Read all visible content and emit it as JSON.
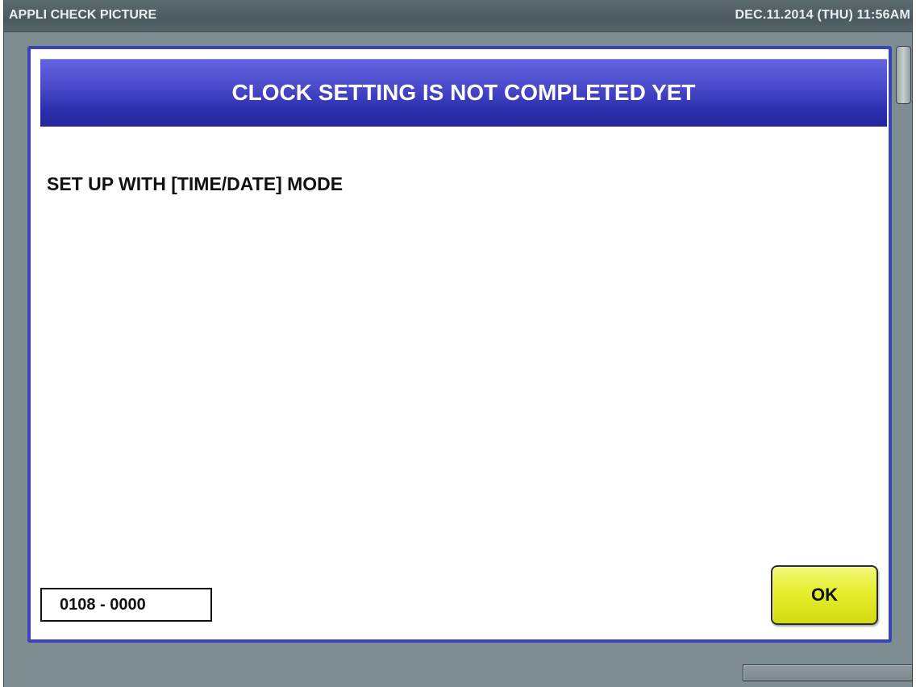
{
  "titlebar": {
    "screen_name": "APPLI CHECK PICTURE",
    "datetime": "DEC.11.2014 (THU)  11:56AM"
  },
  "dialog": {
    "title": "CLOCK SETTING IS NOT COMPLETED YET",
    "message": "SET UP WITH [TIME/DATE] MODE",
    "error_code": "0108 - 0000",
    "ok_label": "OK"
  },
  "colors": {
    "frame_background": "#7e8d91",
    "dialog_border": "#3b43b8",
    "header_blue": "#2c2fae",
    "ok_yellow": "#e7ee2c"
  }
}
